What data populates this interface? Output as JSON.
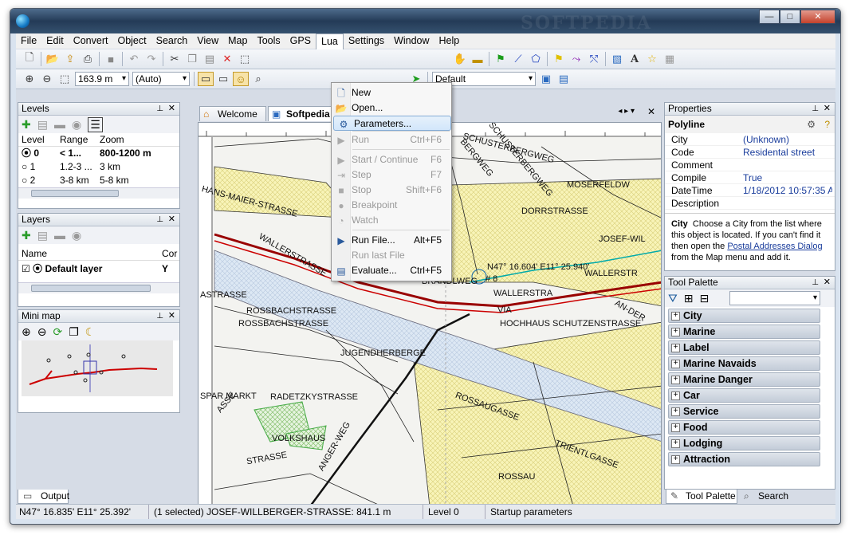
{
  "window": {
    "watermark": "SOFTPEDIA"
  },
  "menu": [
    "File",
    "Edit",
    "Convert",
    "Object",
    "Search",
    "View",
    "Map",
    "Tools",
    "GPS",
    "Lua",
    "Settings",
    "Window",
    "Help"
  ],
  "toolbar2": {
    "scale": "163.9 m",
    "auto": "(Auto)",
    "profile": "Default"
  },
  "lua_menu": [
    {
      "label": "New",
      "shortcut": "",
      "enabled": true,
      "icon": "new-icon"
    },
    {
      "label": "Open...",
      "shortcut": "",
      "enabled": true,
      "icon": "open-icon"
    },
    {
      "label": "Parameters...",
      "shortcut": "",
      "enabled": true,
      "icon": "parameters-icon",
      "highlighted": true
    },
    {
      "label": "Run",
      "shortcut": "Ctrl+F6",
      "enabled": false,
      "icon": "run-icon"
    },
    {
      "label": "Start / Continue",
      "shortcut": "F6",
      "enabled": false,
      "icon": "start-icon"
    },
    {
      "label": "Step",
      "shortcut": "F7",
      "enabled": false,
      "icon": "step-icon"
    },
    {
      "label": "Stop",
      "shortcut": "Shift+F6",
      "enabled": false,
      "icon": "stop-icon"
    },
    {
      "label": "Breakpoint",
      "shortcut": "",
      "enabled": false,
      "icon": "breakpoint-icon"
    },
    {
      "label": "Watch",
      "shortcut": "",
      "enabled": false,
      "icon": "watch-icon"
    },
    {
      "label": "Run File...",
      "shortcut": "Alt+F5",
      "enabled": true,
      "icon": "run-file-icon"
    },
    {
      "label": "Run last File",
      "shortcut": "",
      "enabled": false,
      "icon": ""
    },
    {
      "label": "Evaluate...",
      "shortcut": "Ctrl+F5",
      "enabled": true,
      "icon": "evaluate-icon"
    }
  ],
  "levels": {
    "title": "Levels",
    "columns": [
      "Level",
      "Range",
      "Zoom"
    ],
    "rows": [
      {
        "level": "0",
        "range": "< 1...",
        "zoom": "800-1200 m",
        "selected": true
      },
      {
        "level": "1",
        "range": "1.2-3 ...",
        "zoom": "3 km",
        "selected": false
      },
      {
        "level": "2",
        "range": "3-8 km",
        "zoom": "5-8 km",
        "selected": false
      }
    ]
  },
  "layers": {
    "title": "Layers",
    "columns": [
      "Name",
      "Cor"
    ],
    "rows": [
      {
        "name": "Default layer",
        "col": "Y"
      }
    ]
  },
  "minimap": {
    "title": "Mini map"
  },
  "doc_tabs": [
    {
      "label": "Welcome"
    },
    {
      "label": "Softpedia"
    }
  ],
  "map": {
    "coord_label": "N47° 16.604' E11° 25.940'",
    "labels": [
      "SCHUSTERBERGWEG",
      "MOSERFELDW",
      "DORRSTRASSE",
      "HANS-MAIER-STRASSE",
      "WALLERSTRASSE",
      "JOSEF-WIL",
      "BRANDLWEG",
      "# 8",
      "WALLERSTRA",
      "WALLERSTR",
      "ROSSBACHSTRASSE",
      "ROSSBACHSTRASSE",
      "HOCHHAUS SCHUTZENSTRASSE",
      "ASTRASSE",
      "JUGENDHERBERGE",
      "AN-DER",
      "SPAR MARKT",
      "RADETZKYSTRASSE",
      "ROSSAUGASSE",
      "VOLKSHAUS",
      "TRIENTLGASSE",
      "ROSSAU",
      "ANGER-WEG",
      "STRASSE",
      "ASSE",
      "VIA",
      "SCHUSTERBERGWEG",
      "BERGWEG"
    ]
  },
  "properties": {
    "title": "Properties",
    "object": "Polyline",
    "rows": [
      {
        "key": "City",
        "value": "(Unknown)"
      },
      {
        "key": "Code",
        "value": "Residental street"
      },
      {
        "key": "Comment",
        "value": ""
      },
      {
        "key": "Compile",
        "value": "True"
      },
      {
        "key": "DateTime",
        "value": "1/18/2012 10:57:35 AM"
      },
      {
        "key": "Description",
        "value": ""
      }
    ],
    "help_title": "City",
    "help_text_1": "Choose a City from the list where this object is located. If you can't find it then open the ",
    "help_link": "Postal Addresses Dialog",
    "help_text_2": " from the Map menu and add it."
  },
  "tool_palette": {
    "title": "Tool Palette",
    "items": [
      "City",
      "Marine",
      "Label",
      "Marine Navaids",
      "Marine Danger",
      "Car",
      "Service",
      "Food",
      "Lodging",
      "Attraction"
    ],
    "tabs": [
      "Tool Palette",
      "Search"
    ]
  },
  "output_tab": "Output",
  "status": {
    "coords": "N47° 16.835' E11° 25.392'",
    "selection": "(1 selected) JOSEF-WILLBERGER-STRASSE: 841.1 m",
    "level": "Level 0",
    "message": "Startup parameters"
  }
}
